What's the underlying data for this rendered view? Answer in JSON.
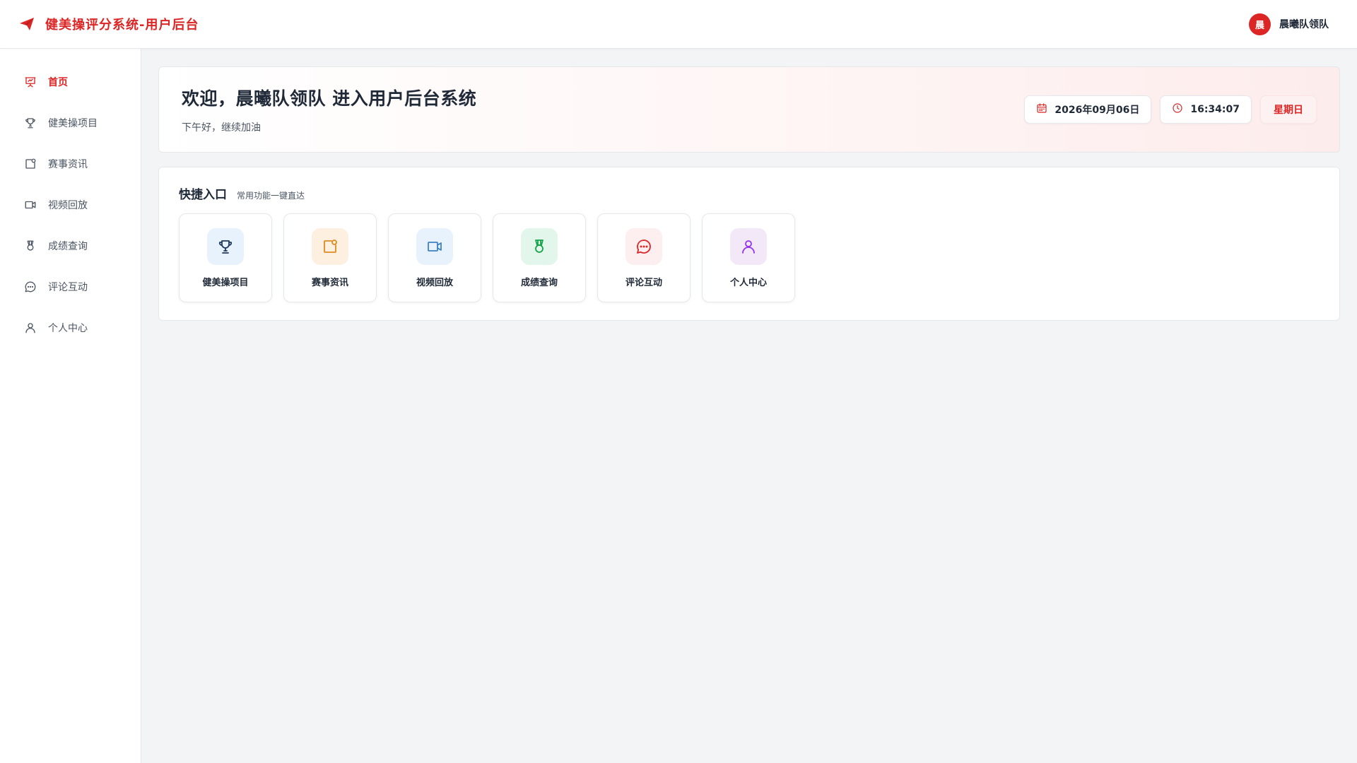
{
  "header": {
    "title": "健美操评分系统-用户后台",
    "brand_icon": "paper-plane-icon",
    "avatar_text": "晨",
    "username": "晨曦队领队"
  },
  "colors": {
    "accent": "#dc2626",
    "text": "#1f2937",
    "muted": "#4b5563",
    "background": "#f3f4f6"
  },
  "sidebar": {
    "items": [
      {
        "label": "首页",
        "icon": "presentation-icon",
        "active": true
      },
      {
        "label": "健美操项目",
        "icon": "trophy-icon",
        "active": false
      },
      {
        "label": "赛事资讯",
        "icon": "news-icon",
        "active": false
      },
      {
        "label": "视频回放",
        "icon": "video-icon",
        "active": false
      },
      {
        "label": "成绩查询",
        "icon": "medal-icon",
        "active": false
      },
      {
        "label": "评论互动",
        "icon": "comment-icon",
        "active": false
      },
      {
        "label": "个人中心",
        "icon": "user-icon",
        "active": false
      }
    ]
  },
  "welcome": {
    "title": "欢迎，晨曦队领队 进入用户后台系统",
    "subtitle": "下午好，继续加油",
    "date": "2026年09月06日",
    "time": "16:34:07",
    "weekday": "星期日"
  },
  "quick": {
    "title": "快捷入口",
    "subtitle": "常用功能一键直达",
    "cards": [
      {
        "label": "健美操项目",
        "icon": "trophy-icon",
        "bg": "#e8f2fd",
        "fg": "#2563eb"
      },
      {
        "label": "赛事资讯",
        "icon": "news-icon",
        "bg": "#fdf0e1",
        "fg": "#e08a1e"
      },
      {
        "label": "视频回放",
        "icon": "video-icon",
        "bg": "#e8f2fd",
        "fg": "#3b82c4"
      },
      {
        "label": "成绩查询",
        "icon": "medal-icon",
        "bg": "#e3f6ec",
        "fg": "#16a34a"
      },
      {
        "label": "评论互动",
        "icon": "comment-icon",
        "bg": "#fdeef0",
        "fg": "#dc2626"
      },
      {
        "label": "个人中心",
        "icon": "user-icon",
        "bg": "#f3e8f8",
        "fg": "#9333ea"
      }
    ]
  }
}
